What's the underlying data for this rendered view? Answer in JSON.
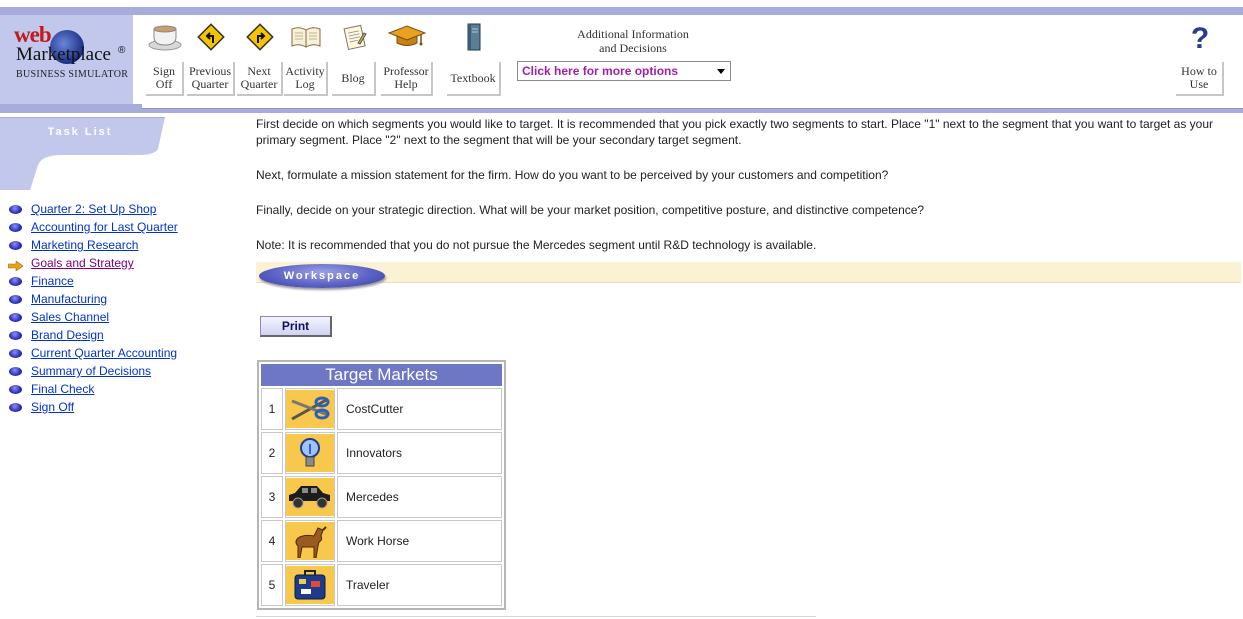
{
  "logo": {
    "web": "web",
    "name": "Marketplace",
    "reg": "®",
    "subtitle": "BUSINESS SIMULATOR"
  },
  "nav": {
    "sign_off": [
      "Sign",
      "Off"
    ],
    "previous_quarter": [
      "Previous",
      "Quarter"
    ],
    "next_quarter": [
      "Next",
      "Quarter"
    ],
    "activity_log": [
      "Activity",
      "Log"
    ],
    "blog": "Blog",
    "professor_help": [
      "Professor",
      "Help"
    ],
    "textbook": "Textbook",
    "how_to_use": [
      "How to",
      "Use"
    ]
  },
  "info": {
    "title_line1": "Additional Information",
    "title_line2": "and Decisions",
    "select_value": "Click here for more options"
  },
  "sidebar": {
    "title": "Task List",
    "items": [
      {
        "label": "Quarter 2: Set Up Shop",
        "current": false
      },
      {
        "label": "Accounting for Last Quarter",
        "current": false
      },
      {
        "label": "Marketing Research",
        "current": false
      },
      {
        "label": "Goals and Strategy",
        "current": true
      },
      {
        "label": "Finance",
        "current": false
      },
      {
        "label": "Manufacturing",
        "current": false
      },
      {
        "label": "Sales Channel",
        "current": false
      },
      {
        "label": "Brand Design",
        "current": false
      },
      {
        "label": "Current Quarter Accounting",
        "current": false
      },
      {
        "label": "Summary of Decisions",
        "current": false
      },
      {
        "label": "Final Check",
        "current": false
      },
      {
        "label": "Sign Off",
        "current": false
      }
    ]
  },
  "main": {
    "instructions": [
      "First decide on which segments you would like to target. It is recommended that you pick exactly two segments to start. Place \"1\" next to the segment that you want to target as your primary segment. Place \"2\" next to the segment that will be your secondary target segment.",
      "Next, formulate a mission statement for the firm. How do you want to be perceived by your customers and competition?",
      "Finally, decide on your strategic direction. What will be your market position, competitive posture, and distinctive competence?",
      "Note: It is recommended that you do not pursue the Mercedes segment until R&D technology is available."
    ],
    "workspace_label": "Workspace",
    "print_label": "Print",
    "table_title": "Target Markets",
    "segments": [
      {
        "rank": "1",
        "name": "CostCutter",
        "icon": "scissors-icon"
      },
      {
        "rank": "2",
        "name": "Innovators",
        "icon": "lightbulb-icon"
      },
      {
        "rank": "3",
        "name": "Mercedes",
        "icon": "car-icon"
      },
      {
        "rank": "4",
        "name": "Work Horse",
        "icon": "horse-icon"
      },
      {
        "rank": "5",
        "name": "Traveler",
        "icon": "suitcase-icon"
      }
    ]
  },
  "colors": {
    "header_band": "#a7acdc",
    "logo_panel": "#c1c8ec",
    "link": "#0033cc",
    "visited_link": "#800080",
    "table_header": "#6d77c4",
    "segment_icon_bg": "#f7c84c",
    "workspace_band": "#fbf2d3",
    "select_text": "#a21ea6"
  }
}
